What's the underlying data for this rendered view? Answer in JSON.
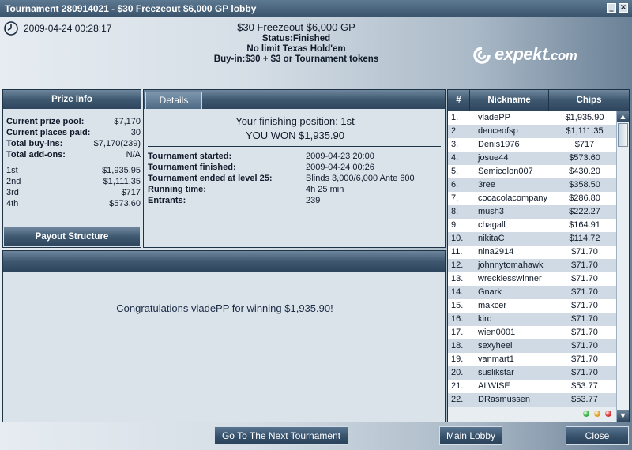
{
  "window": {
    "title": "Tournament 280914021 - $30 Freezeout $6,000 GP lobby"
  },
  "header": {
    "datetime": "2009-04-24 00:28:17",
    "name": "$30 Freezeout $6,000 GP",
    "status": "Status:Finished",
    "game": "No limit Texas Hold'em",
    "buyin": "Buy-in:$30 + $3 or Tournament tokens",
    "logo_text": "expekt",
    "logo_suffix": ".com"
  },
  "prize_info": {
    "title": "Prize Info",
    "rows": [
      {
        "label": "Current prize pool:",
        "value": "$7,170"
      },
      {
        "label": "Current places paid:",
        "value": "30"
      },
      {
        "label": "Total buy-ins:",
        "value": "$7,170(239)"
      },
      {
        "label": "Total add-ons:",
        "value": "N/A"
      }
    ],
    "places": [
      {
        "label": "1st",
        "value": "$1,935.95"
      },
      {
        "label": "2nd",
        "value": "$1,111.35"
      },
      {
        "label": "3rd",
        "value": "$717"
      },
      {
        "label": "4th",
        "value": "$573.60"
      }
    ],
    "payout_button": "Payout Structure"
  },
  "details": {
    "tab_label": "Details",
    "finishing_position": "Your finishing position:  1st",
    "you_won": "YOU WON $1,935.90",
    "rows": [
      {
        "label": "Tournament started:",
        "value": "2009-04-23 20:00"
      },
      {
        "label": "Tournament finished:",
        "value": "2009-04-24 00:26"
      },
      {
        "label": "Tournament ended at level 25:",
        "value": "Blinds 3,000/6,000 Ante 600"
      },
      {
        "label": "Running time:",
        "value": "4h 25 min"
      },
      {
        "label": "Entrants:",
        "value": "239"
      }
    ]
  },
  "congrats": {
    "message": "Congratulations vladePP for winning $1,935.90!"
  },
  "players": {
    "headers": {
      "num": "#",
      "nick": "Nickname",
      "chips": "Chips"
    },
    "rows": [
      {
        "n": "1.",
        "nick": "vladePP",
        "chips": "$1,935.90"
      },
      {
        "n": "2.",
        "nick": "deuceofsp",
        "chips": "$1,111.35"
      },
      {
        "n": "3.",
        "nick": "Denis1976",
        "chips": "$717"
      },
      {
        "n": "4.",
        "nick": "josue44",
        "chips": "$573.60"
      },
      {
        "n": "5.",
        "nick": "Semicolon007",
        "chips": "$430.20"
      },
      {
        "n": "6.",
        "nick": "3ree",
        "chips": "$358.50"
      },
      {
        "n": "7.",
        "nick": "cocacolacompany",
        "chips": "$286.80"
      },
      {
        "n": "8.",
        "nick": "mush3",
        "chips": "$222.27"
      },
      {
        "n": "9.",
        "nick": "chagall",
        "chips": "$164.91"
      },
      {
        "n": "10.",
        "nick": "nikitaC",
        "chips": "$114.72"
      },
      {
        "n": "11.",
        "nick": "nina2914",
        "chips": "$71.70"
      },
      {
        "n": "12.",
        "nick": "johnnytomahawk",
        "chips": "$71.70"
      },
      {
        "n": "13.",
        "nick": "wrecklesswinner",
        "chips": "$71.70"
      },
      {
        "n": "14.",
        "nick": "Gnark",
        "chips": "$71.70"
      },
      {
        "n": "15.",
        "nick": "makcer",
        "chips": "$71.70"
      },
      {
        "n": "16.",
        "nick": "kird",
        "chips": "$71.70"
      },
      {
        "n": "17.",
        "nick": "wien0001",
        "chips": "$71.70"
      },
      {
        "n": "18.",
        "nick": "sexyheel",
        "chips": "$71.70"
      },
      {
        "n": "19.",
        "nick": "vanmart1",
        "chips": "$71.70"
      },
      {
        "n": "20.",
        "nick": "suslikstar",
        "chips": "$71.70"
      },
      {
        "n": "21.",
        "nick": "ALWISE",
        "chips": "$53.77"
      },
      {
        "n": "22.",
        "nick": "DRasmussen",
        "chips": "$53.77"
      }
    ],
    "status_dots": [
      "#3cb043",
      "#e0a020",
      "#d83030"
    ]
  },
  "buttons": {
    "next_tournament": "Go To The Next Tournament",
    "main_lobby": "Main Lobby",
    "close": "Close"
  },
  "icons": [
    "clock-icon",
    "minimize-icon",
    "close-window-icon",
    "scroll-up-icon",
    "scroll-down-icon",
    "expekt-logo-icon"
  ]
}
